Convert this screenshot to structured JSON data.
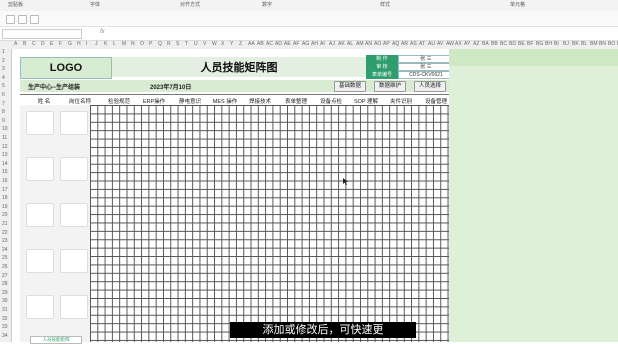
{
  "ribbon": {
    "groups": [
      "剪贴板",
      "字体",
      "对齐方式",
      "数字",
      "样式",
      "单元格"
    ]
  },
  "formula_bar": {
    "fx_label": "fx"
  },
  "sheet": {
    "logo": "LOGO",
    "title": "人员技能矩阵图",
    "info": [
      {
        "label": "制 作",
        "value": "张 三"
      },
      {
        "label": "审 核",
        "value": "张 三"
      },
      {
        "label": "表单编号",
        "value": "CDS-CKV0021"
      }
    ],
    "dept": "生产中心--生产组装",
    "date": "2023年7月10日",
    "buttons": [
      "基础数据",
      "数据维护",
      "人员选择"
    ],
    "headers": [
      "姓 名",
      "岗位名称",
      "检验规范",
      "ERP操作",
      "静电意识",
      "MES 操作",
      "焊接技术",
      "表单整理",
      "设备点检",
      "SOP 理解",
      "夹件识别",
      "设备管理"
    ]
  },
  "row_numbers": [
    "1",
    "2",
    "3",
    "4",
    "5",
    "6",
    "7",
    "8",
    "9",
    "10",
    "11",
    "12",
    "13",
    "14",
    "15",
    "16",
    "17",
    "18",
    "19",
    "20",
    "21",
    "22",
    "23",
    "24",
    "25",
    "26",
    "27",
    "28",
    "29",
    "30",
    "31",
    "32",
    "33",
    "34"
  ],
  "column_letters": [
    "A",
    "B",
    "C",
    "D",
    "E",
    "F",
    "G",
    "H",
    "I",
    "J",
    "K",
    "L",
    "M",
    "N",
    "O",
    "P",
    "Q",
    "R",
    "S",
    "T",
    "U",
    "V",
    "W",
    "X",
    "Y",
    "Z",
    "AA",
    "AB",
    "AC",
    "AD",
    "AE",
    "AF",
    "AG",
    "AH",
    "AI",
    "AJ",
    "AK",
    "AL",
    "AM",
    "AN",
    "AO",
    "AP",
    "AQ",
    "AR",
    "AS",
    "AT",
    "AU",
    "AV",
    "AW",
    "AX",
    "AY",
    "AZ",
    "BA",
    "BB",
    "BC",
    "BD",
    "BE",
    "BF",
    "BG",
    "BH",
    "BI",
    "BJ",
    "BK",
    "BL",
    "BM",
    "BN",
    "BO",
    "BP"
  ],
  "subtitle": "添加或修改后，可快速更",
  "sheet_tab": "人员技能矩阵",
  "colors": {
    "accent_green": "#2e9e6d",
    "panel_green": "#dff0d8"
  }
}
